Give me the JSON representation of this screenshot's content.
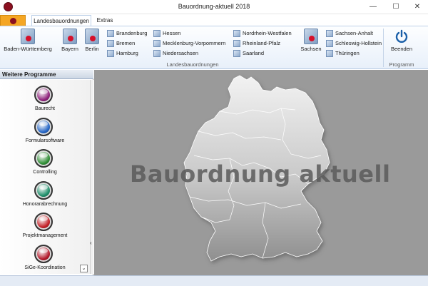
{
  "window": {
    "title": "Bauordnung-aktuell 2018",
    "minimize": "—",
    "maximize": "☐",
    "close": "✕"
  },
  "tabs": [
    {
      "label": "Landesbauordnungen",
      "active": true
    },
    {
      "label": "Extras",
      "active": false
    }
  ],
  "ribbon": {
    "groups": [
      {
        "label": "Landesbauordnungen"
      },
      {
        "label": "Programm"
      }
    ],
    "large_buttons": [
      "Baden-Württemberg",
      "Bayern",
      "Berlin",
      "Sachsen",
      "Beenden"
    ],
    "small_buttons": [
      "Brandenburg",
      "Bremen",
      "Hamburg",
      "Hessen",
      "Mecklenburg-Vorpommern",
      "Niedersachsen",
      "Nordrhein-Westfalen",
      "Rheinland-Pfalz",
      "Saarland",
      "Sachsen-Anhalt",
      "Schleswig-Hollstein",
      "Thüringen"
    ]
  },
  "panel": {
    "title": "Weitere Programme",
    "items": [
      {
        "label": "Baurecht",
        "color": "#8e1f7a"
      },
      {
        "label": "Formularsoftware",
        "color": "#2566c7"
      },
      {
        "label": "Controlling",
        "color": "#2f8f35"
      },
      {
        "label": "Honorarabrechnung",
        "color": "#1e8f6a"
      },
      {
        "label": "Projektmanagement",
        "color": "#c41f26"
      },
      {
        "label": "SiGe-Koordination",
        "color": "#b3182a"
      }
    ]
  },
  "main": {
    "watermark": "Bauordnung aktuell"
  },
  "colors": {
    "accent": "#f5a623",
    "ribbon_border": "#b8cce4",
    "map_bg": "#9a9a9a"
  }
}
